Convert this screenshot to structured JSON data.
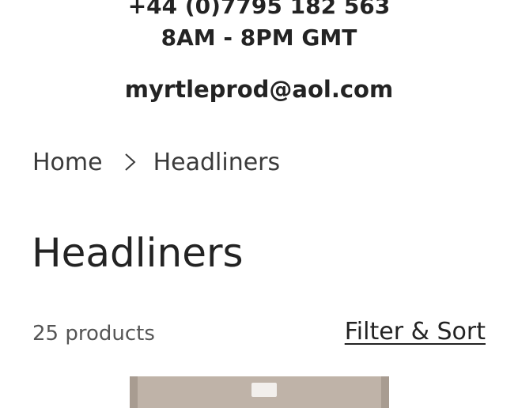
{
  "contact": {
    "phone": "+44 (0)7795 182 563",
    "hours": "8AM - 8PM GMT",
    "email": "myrtleprod@aol.com"
  },
  "breadcrumb": {
    "home": "Home",
    "current": "Headliners"
  },
  "collection": {
    "title": "Headliners",
    "product_count": "25 products",
    "filter_sort_label": "Filter & Sort"
  },
  "colors": {
    "text": "#232323",
    "product_tan": "#bfb3a8"
  },
  "icons": {
    "breadcrumb_separator": "chevron-right-icon"
  }
}
